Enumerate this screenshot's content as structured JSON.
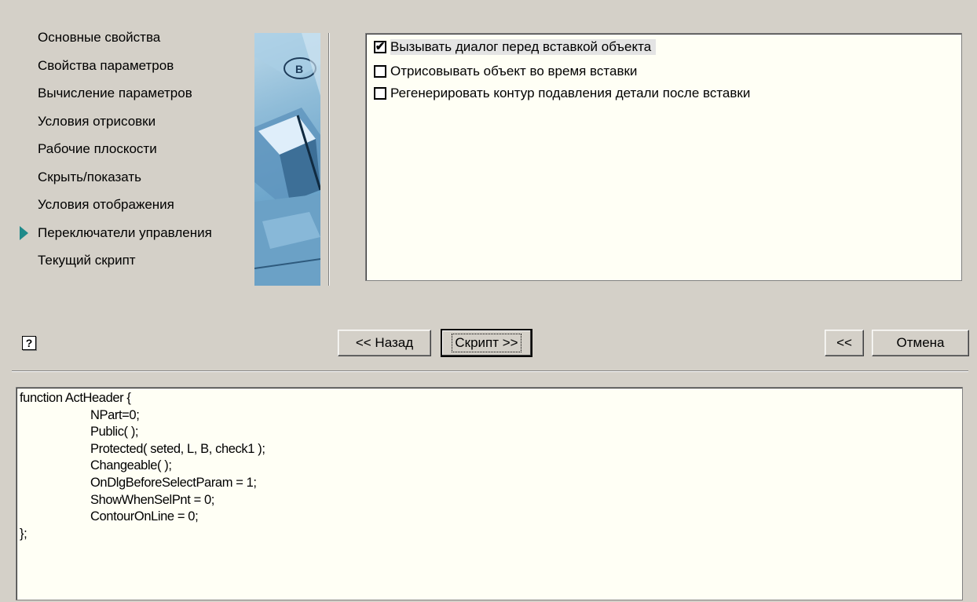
{
  "nav": {
    "items": [
      {
        "label": "Основные свойства",
        "active": false
      },
      {
        "label": "Свойства параметров",
        "active": false
      },
      {
        "label": "Вычисление параметров",
        "active": false
      },
      {
        "label": "Условия отрисовки",
        "active": false
      },
      {
        "label": "Рабочие плоскости",
        "active": false
      },
      {
        "label": "Скрыть/показать",
        "active": false
      },
      {
        "label": "Условия отображения",
        "active": false
      },
      {
        "label": "Переключатели управления",
        "active": true
      },
      {
        "label": "Текущий скрипт",
        "active": false
      }
    ]
  },
  "options": [
    {
      "label": "Вызывать диалог перед вставкой объекта",
      "checked": true,
      "selected": true
    },
    {
      "label": "Отрисовывать объект во время вставки",
      "checked": false,
      "selected": false
    },
    {
      "label": "Регенерировать контур подавления детали после вставки",
      "checked": false,
      "selected": false
    }
  ],
  "buttons": {
    "back": "<< Назад",
    "script": "Скрипт >>",
    "collapse": "<<",
    "cancel": "Отмена"
  },
  "help": {
    "symbol": "?"
  },
  "picture": {
    "label": "B"
  },
  "script": {
    "lines": [
      {
        "text": "function ActHeader {",
        "indent": false
      },
      {
        "text": "NPart=0;",
        "indent": true
      },
      {
        "text": "Public( );",
        "indent": true
      },
      {
        "text": "Protected( seted, L, B, check1 );",
        "indent": true
      },
      {
        "text": "Changeable( );",
        "indent": true
      },
      {
        "text": "OnDlgBeforeSelectParam = 1;",
        "indent": true
      },
      {
        "text": "ShowWhenSelPnt = 0;",
        "indent": true
      },
      {
        "text": "ContourOnLine = 0;",
        "indent": true
      },
      {
        "text": "};",
        "indent": false
      }
    ]
  },
  "colors": {
    "dialog_bg": "#d4d0c8",
    "field_bg": "#fffff5",
    "active_arrow": "#1f8a8a"
  }
}
